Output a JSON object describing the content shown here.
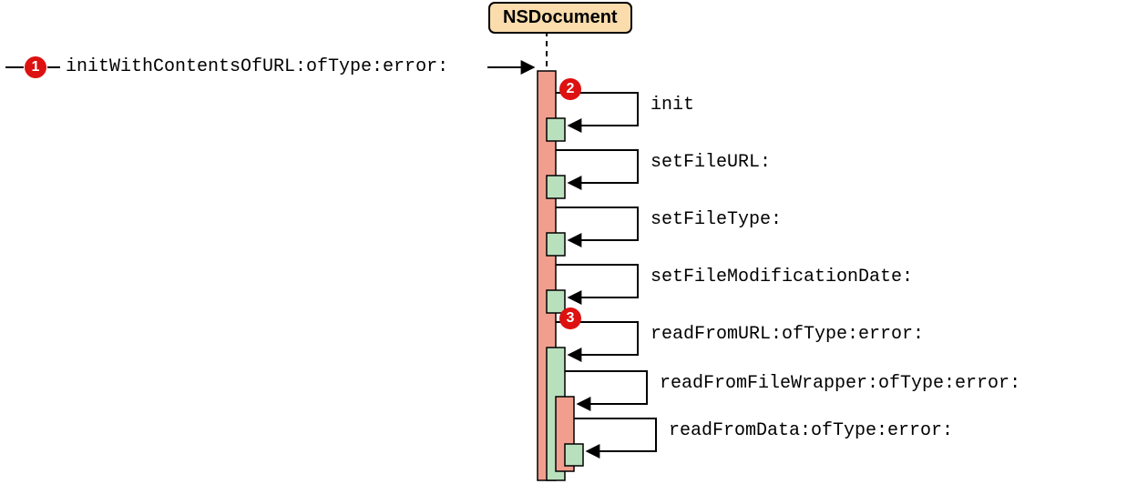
{
  "class_name": "NSDocument",
  "badges": {
    "b1": "1",
    "b2": "2",
    "b3": "3"
  },
  "labels": {
    "entry": "initWithContentsOfURL:ofType:error:",
    "m1": "init",
    "m2": "setFileURL:",
    "m3": "setFileType:",
    "m4": "setFileModificationDate:",
    "m5": "readFromURL:ofType:error:",
    "m6": "readFromFileWrapper:ofType:error:",
    "m7": "readFromData:ofType:error:"
  },
  "colors": {
    "salmon": "#f29e8e",
    "mint": "#b9e0bd",
    "red": "#d11",
    "box_bg": "#fadcad"
  }
}
